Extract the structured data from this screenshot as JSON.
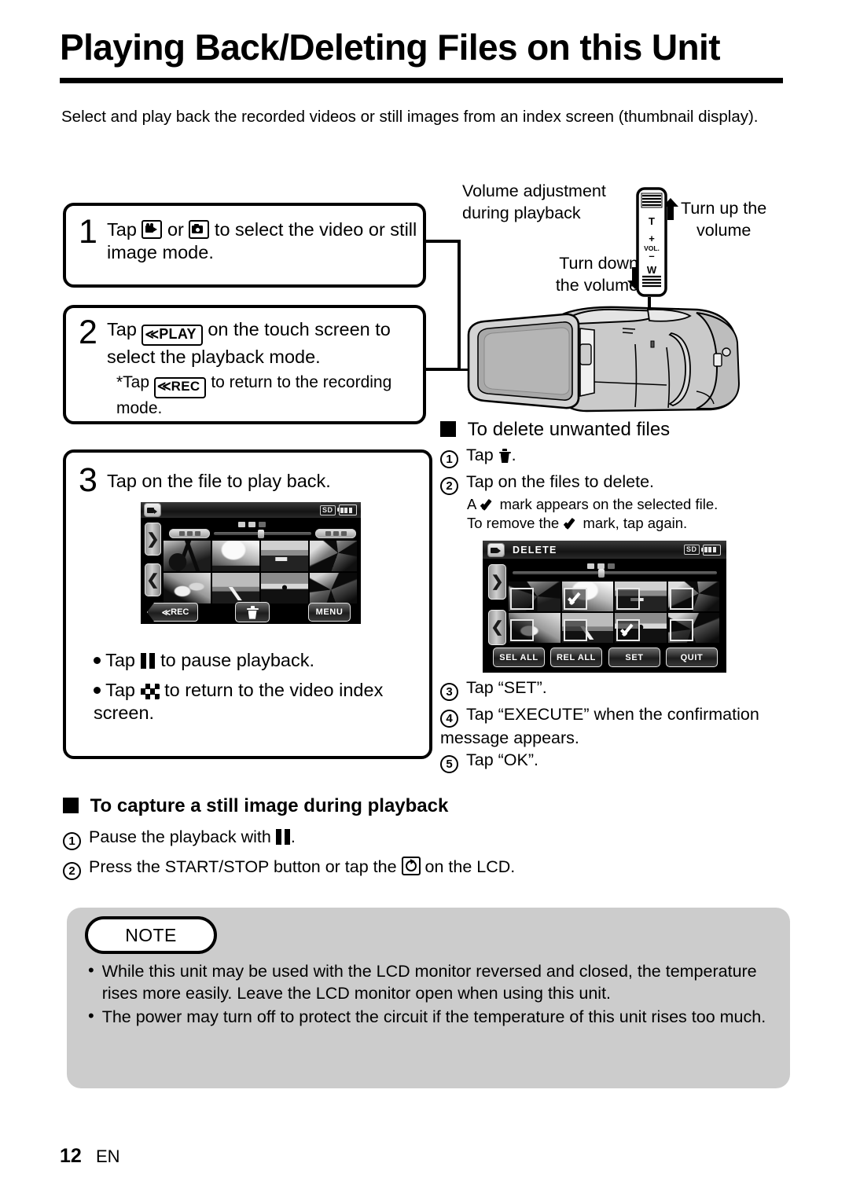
{
  "page": {
    "title": "Playing Back/Deleting Files on this Unit",
    "intro": "Select and play back the recorded videos or still images from an index screen (thumbnail display).",
    "number": "12",
    "language": "EN"
  },
  "steps": [
    {
      "number": "1",
      "text_before": "Tap",
      "icon_a": "video-mode-icon",
      "text_mid": "or",
      "icon_b": "still-image-mode-icon",
      "text_after": "to select the video or still image mode."
    },
    {
      "number": "2",
      "text_before": "Tap",
      "token": "PLAY",
      "text_after": "on the touch screen to select the playback mode.",
      "note_prefix": "*Tap",
      "note_token": "REC",
      "note_after": "to return to the recording mode."
    },
    {
      "number": "3",
      "text": "Tap on the file to play back.",
      "bullets": [
        {
          "before": "Tap",
          "icon": "pause-icon",
          "after": "to pause playback."
        },
        {
          "before": "Tap",
          "icon": "index-screen-icon",
          "after": "to return to the video index screen."
        }
      ]
    }
  ],
  "volume": {
    "caption_line1": "Volume adjustment",
    "caption_line2": "during playback",
    "turn_up_line1": "Turn up the",
    "turn_up_line2": "volume",
    "turn_down_line1": "Turn down",
    "turn_down_line2": "the volume",
    "lever_top": "T",
    "lever_plus": "+",
    "lever_label": "VOL.",
    "lever_minus": "–",
    "lever_bottom": "W"
  },
  "index_screen": {
    "mode_icon": "video-mode-icon",
    "title": "",
    "sd_badge": "SD",
    "battery_icon": "battery-icon",
    "next_arrow": "❯",
    "prev_arrow": "❮",
    "buttons": {
      "rec": "REC",
      "delete": "delete-icon",
      "menu": "MENU"
    },
    "thumbnail_count": 8
  },
  "delete_section": {
    "heading": "To delete unwanted files",
    "items": [
      {
        "num": "1",
        "before": "Tap",
        "icon": "trash-icon",
        "after": "."
      },
      {
        "num": "2",
        "text": "Tap on the files to delete."
      },
      {
        "num": "3",
        "text": "Tap “SET”."
      },
      {
        "num": "4",
        "text": "Tap “EXECUTE” when the confirmation message appears."
      },
      {
        "num": "5",
        "text": "Tap “OK”."
      }
    ],
    "check_note_line1_a": "A",
    "check_note_line1_b": "mark appears on the selected file.",
    "check_note_line2_a": "To remove the",
    "check_note_line2_b": "mark, tap again."
  },
  "delete_screen": {
    "mode_icon": "video-mode-icon",
    "title": "DELETE",
    "sd_badge": "SD",
    "battery_icon": "battery-icon",
    "next_arrow": "❯",
    "prev_arrow": "❮",
    "buttons": [
      "SEL ALL",
      "REL ALL",
      "SET",
      "QUIT"
    ],
    "thumbnail_count": 8,
    "checked_indices": [
      1,
      6
    ]
  },
  "capture_section": {
    "heading": "To capture a still image during playback",
    "item1": {
      "num": "1",
      "before": "Pause the playback with",
      "icon": "pause-icon",
      "after": "."
    },
    "item2": {
      "num": "2",
      "before": "Press the START/STOP button or tap the",
      "icon": "snapshot-icon",
      "after": "on the LCD."
    }
  },
  "note": {
    "label": "NOTE",
    "bullets": [
      "While this unit may be used with the LCD monitor reversed and closed, the temperature rises more easily. Leave the LCD monitor open when using this unit.",
      "The power may turn off to protect the circuit if the temperature of this unit rises too much."
    ]
  },
  "colors": {
    "note_bg": "#cccccc",
    "lcd_bg": "#000000",
    "body_fill": "#c8c8c8"
  }
}
